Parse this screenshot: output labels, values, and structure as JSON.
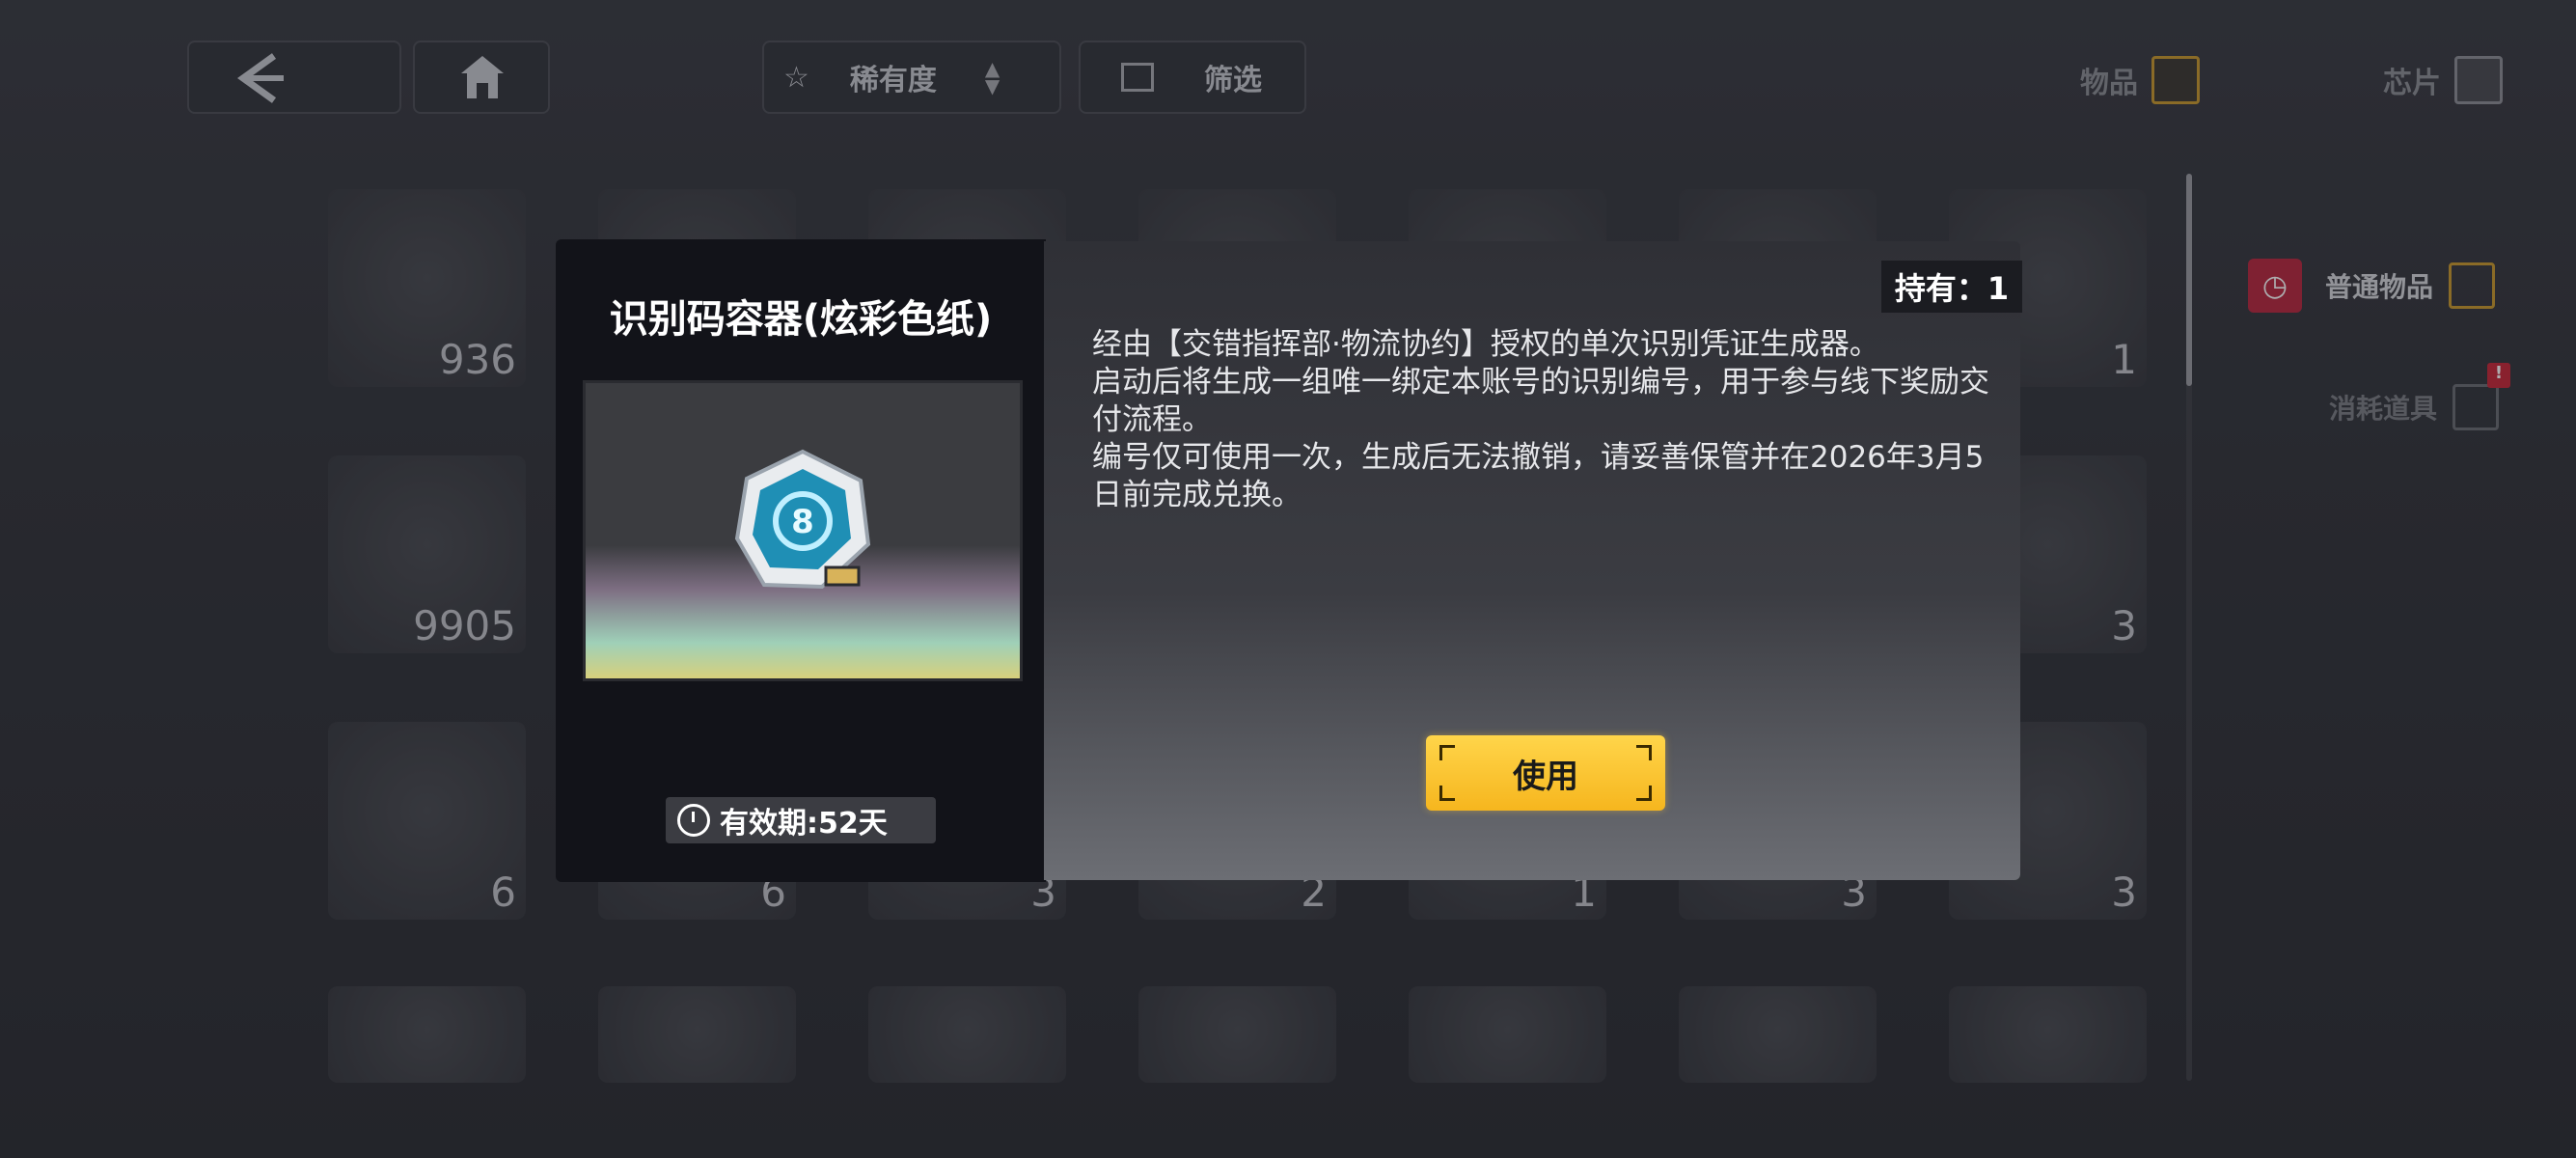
{
  "topbar": {
    "sort_label": "稀有度",
    "filter_label": "筛选",
    "tab_items": "物品",
    "tab_chips": "芯片"
  },
  "inventory": {
    "counts_row1": [
      "936",
      "",
      "",
      "",
      "",
      "",
      "1"
    ],
    "counts_row2": [
      "9905",
      "",
      "",
      "",
      "",
      "",
      "3"
    ],
    "counts_row3": [
      "6",
      "6",
      "3",
      "2",
      "1",
      "3",
      "3"
    ]
  },
  "categories": {
    "normal": "普通物品",
    "consumable": "消耗道具",
    "consumable_badge": "!"
  },
  "modal": {
    "title": "识别码容器(炫彩色纸)",
    "owned": "持有：1",
    "expire": "有效期:52天",
    "description": [
      "经由【交错指挥部·物流协约】授权的单次识别凭证生成器。",
      "启动后将生成一组唯一绑定本账号的识别编号，用于参与线下奖励交付流程。",
      "编号仅可使用一次，生成后无法撤销，请妥善保管并在2026年3月5日前完成兑换。"
    ],
    "use_label": "使用"
  },
  "colors": {
    "accent_gold": "#f6b61e",
    "category_red": "#b8283f"
  }
}
